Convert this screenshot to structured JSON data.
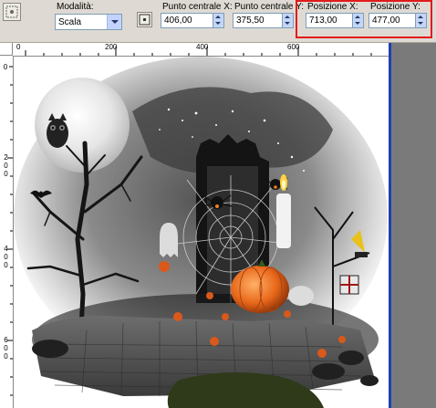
{
  "toolbar": {
    "mode_label": "Modalità:",
    "mode_value": "Scala",
    "center_x_label": "Punto centrale X:",
    "center_x_value": "406,00",
    "center_y_label": "Punto centrale Y:",
    "center_y_value": "375,50",
    "pos_x_label": "Posizione X:",
    "pos_x_value": "713,00",
    "pos_y_label": "Posizione Y:",
    "pos_y_value": "477,00",
    "highlight_color": "#e21b1b"
  },
  "ruler": {
    "top_labels": [
      "0",
      "200",
      "400",
      "600"
    ],
    "left_labels": [
      "0",
      "200",
      "400",
      "600"
    ]
  },
  "canvas": {
    "description_icons": [
      "moon",
      "owl",
      "tree",
      "candle",
      "spider-web",
      "pumpkin",
      "bat",
      "ghost"
    ]
  }
}
